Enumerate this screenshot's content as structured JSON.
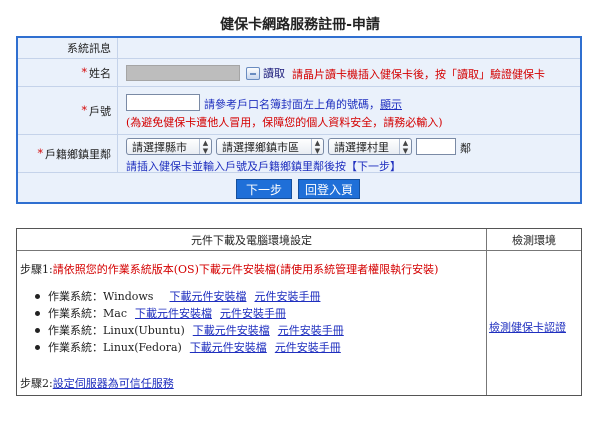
{
  "page": {
    "title": "健保卡網路服務註冊-申請"
  },
  "form": {
    "system_label": "系統訊息",
    "name": {
      "required": "*",
      "label": "姓名",
      "read_button": "讀取",
      "hint": "請晶片讀卡機插入健保卡後，按「讀取」驗證健保卡"
    },
    "household": {
      "required": "*",
      "label": "戶號",
      "hint_prefix": "請參考戶口名簿封面左上角的號碼，",
      "hint_link": "顯示",
      "warning": "(為避免健保卡遭他人冒用，保障您的個人資料安全，請務必輸入)"
    },
    "address": {
      "required": "*",
      "label": "戶籍鄉鎮里鄰",
      "county_select": "請選擇縣市",
      "town_select": "請選擇鄉鎮市區",
      "village_select": "請選擇村里",
      "neighbor_suffix": "鄰",
      "hint": "請插入健保卡並輸入戶號及戶籍鄉鎮里鄰後按【下一步】"
    },
    "next_button": "下一步",
    "back_button": "回登入頁"
  },
  "downloads": {
    "header_left": "元件下載及電腦環境設定",
    "header_right": "檢測環境",
    "step1_label": "步驟1:",
    "step1_text": "請依照您的作業系統版本(OS)下載元件安裝檔(請使用系統管理者權限執行安裝)",
    "os_list": [
      {
        "os": "作業系統：Windows",
        "download": "下載元件安裝檔",
        "manual": "元件安裝手冊"
      },
      {
        "os": "作業系統：Mac",
        "download": "下載元件安裝檔",
        "manual": "元件安裝手冊"
      },
      {
        "os": "作業系統：Linux(Ubuntu)",
        "download": "下載元件安裝檔",
        "manual": "元件安裝手冊"
      },
      {
        "os": "作業系統：Linux(Fedora)",
        "download": "下載元件安裝檔",
        "manual": "元件安裝手冊"
      }
    ],
    "step2_label": "步驟2:",
    "step2_link": "設定伺服器為可信任服務",
    "check_link": "檢測健保卡認證"
  }
}
